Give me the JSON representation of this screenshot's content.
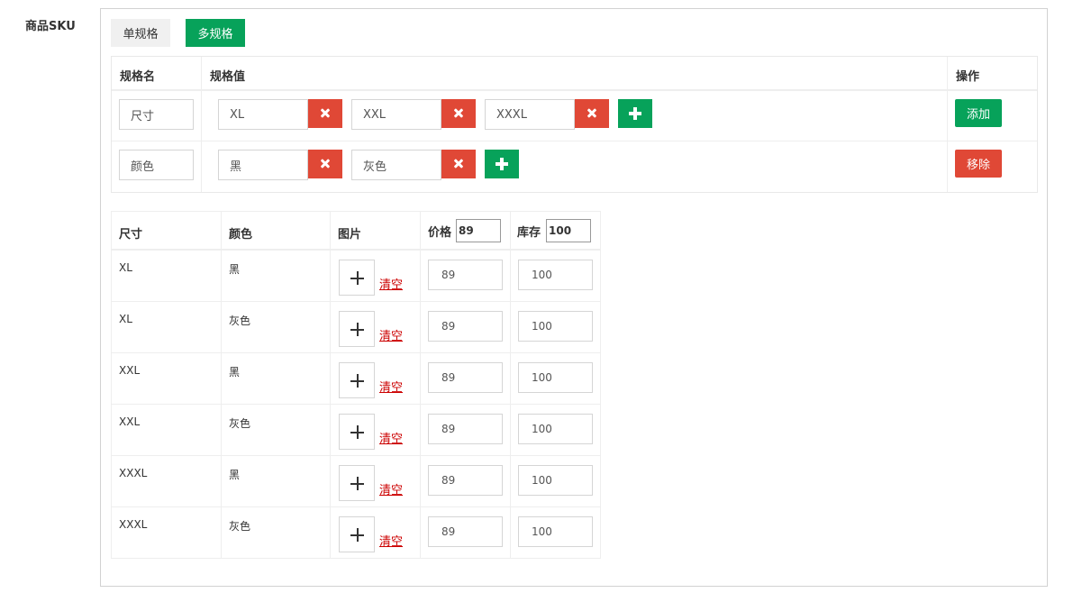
{
  "field_label": "商品SKU",
  "mode_buttons": {
    "single": "单规格",
    "multi": "多规格"
  },
  "spec_table": {
    "headers": {
      "name": "规格名",
      "values": "规格值",
      "ops": "操作"
    },
    "rows": [
      {
        "name": "尺寸",
        "values": [
          "XL",
          "XXL",
          "XXXL"
        ],
        "op_label": "添加"
      },
      {
        "name": "颜色",
        "values": [
          "黑",
          "灰色"
        ],
        "op_label": "移除"
      }
    ]
  },
  "sku_table": {
    "headers": {
      "col1": "尺寸",
      "col2": "颜色",
      "image": "图片",
      "price": "价格",
      "stock": "库存"
    },
    "batch_price": "89",
    "batch_stock": "100",
    "clear_label": "清空",
    "rows": [
      {
        "size": "XL",
        "color": "黑",
        "price": "89",
        "stock": "100"
      },
      {
        "size": "XL",
        "color": "灰色",
        "price": "89",
        "stock": "100"
      },
      {
        "size": "XXL",
        "color": "黑",
        "price": "89",
        "stock": "100"
      },
      {
        "size": "XXL",
        "color": "灰色",
        "price": "89",
        "stock": "100"
      },
      {
        "size": "XXXL",
        "color": "黑",
        "price": "89",
        "stock": "100"
      },
      {
        "size": "XXXL",
        "color": "灰色",
        "price": "89",
        "stock": "100"
      }
    ]
  },
  "colors": {
    "green": "#07a25a",
    "red": "#e04836",
    "link_red": "#cc0000"
  },
  "icons": {
    "delete": "close-x-icon",
    "add": "plus-icon",
    "image_add": "plus-icon"
  }
}
